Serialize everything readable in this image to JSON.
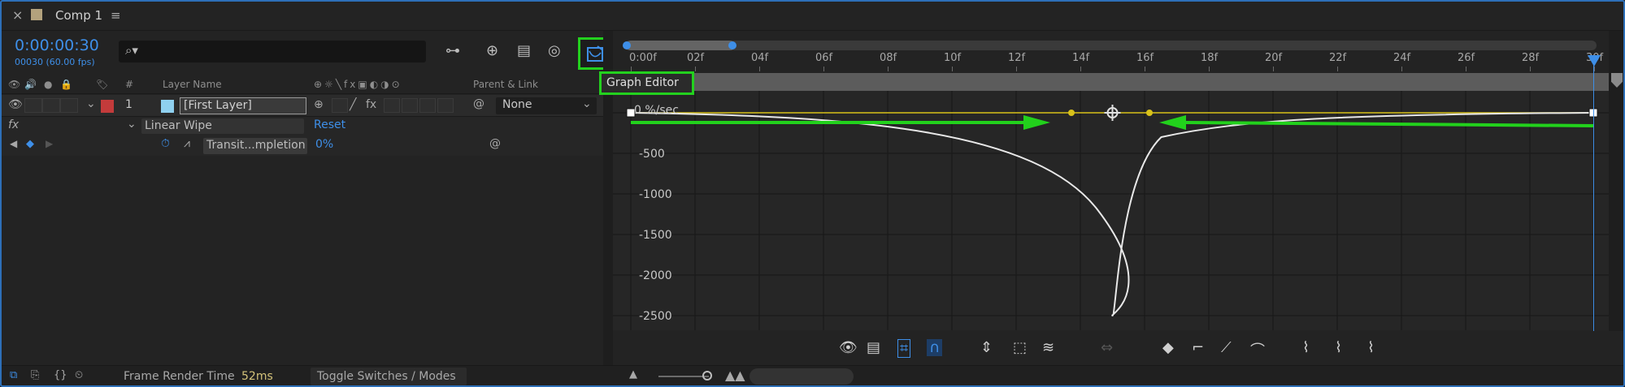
{
  "tab": {
    "close": "×",
    "title": "Comp 1",
    "menu": "≡"
  },
  "timecode": {
    "value": "0:00:00:30",
    "frames": "00030 (60.00 fps)"
  },
  "search": {
    "icon": "search-icon",
    "value": ""
  },
  "columns": {
    "hash": "#",
    "layer_name": "Layer Name",
    "parent_link": "Parent & Link"
  },
  "layer": {
    "index": "1",
    "name": "[First Layer]",
    "label_color": "#c33b3b",
    "source_color": "#8fd0ef",
    "parent": "None"
  },
  "effect": {
    "fx": "fx",
    "name": "Linear Wipe",
    "reset": "Reset"
  },
  "property": {
    "name": "Transit...mpletion",
    "value": "0%"
  },
  "tooltip": "Graph Editor",
  "ruler": {
    "ticks": [
      "0:00f",
      "02f",
      "04f",
      "06f",
      "08f",
      "10f",
      "12f",
      "14f",
      "16f",
      "18f",
      "20f",
      "22f",
      "24f",
      "26f",
      "28f",
      "30f"
    ]
  },
  "graph": {
    "y_labels": [
      "0 %/sec",
      "-500",
      "-1000",
      "-1500",
      "-2000",
      "-2500"
    ],
    "y_values": [
      0,
      -500,
      -1000,
      -1500,
      -2000,
      -2500
    ],
    "curve_color": "#e8e8e8",
    "influence_color": "#d9c21a",
    "arrow_color": "#22d11c"
  },
  "status": {
    "frame_render_label": "Frame Render Time",
    "frame_render_value": "52ms",
    "toggle": "Toggle Switches / Modes"
  },
  "colors": {
    "accent": "#3e8fe8",
    "highlight": "#23d11e"
  }
}
